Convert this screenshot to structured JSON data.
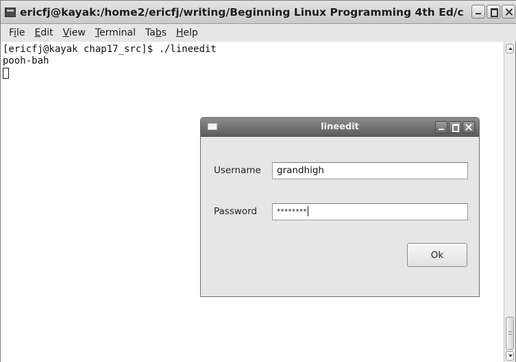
{
  "terminal": {
    "title": "ericfj@kayak:/home2/ericfj/writing/Beginning Linux Programming 4th Ed/c",
    "menu": [
      {
        "label": "File",
        "mnemonic": "i"
      },
      {
        "label": "Edit",
        "mnemonic": "E"
      },
      {
        "label": "View",
        "mnemonic": "V"
      },
      {
        "label": "Terminal",
        "mnemonic": "T"
      },
      {
        "label": "Tabs",
        "mnemonic": "b"
      },
      {
        "label": "Help",
        "mnemonic": "H"
      }
    ],
    "lines": [
      "[ericfj@kayak chap17_src]$ ./lineedit",
      "pooh-bah"
    ]
  },
  "dialog": {
    "title": "lineedit",
    "username_label": "Username",
    "username_value": "grandhigh",
    "password_label": "Password",
    "password_value": "********",
    "ok_label": "Ok"
  },
  "icons": {
    "terminal_window": "terminal-app-icon",
    "dialog_window": "window-icon",
    "minimize": "minimize-icon",
    "maximize": "maximize-icon",
    "close": "close-icon",
    "scroll_up": "arrow-up-icon",
    "scroll_down": "arrow-down-icon"
  },
  "colors": {
    "dialog_titlebar": "#6e6e6e",
    "dialog_background": "#e6e6e6",
    "terminal_background": "#ffffff"
  }
}
